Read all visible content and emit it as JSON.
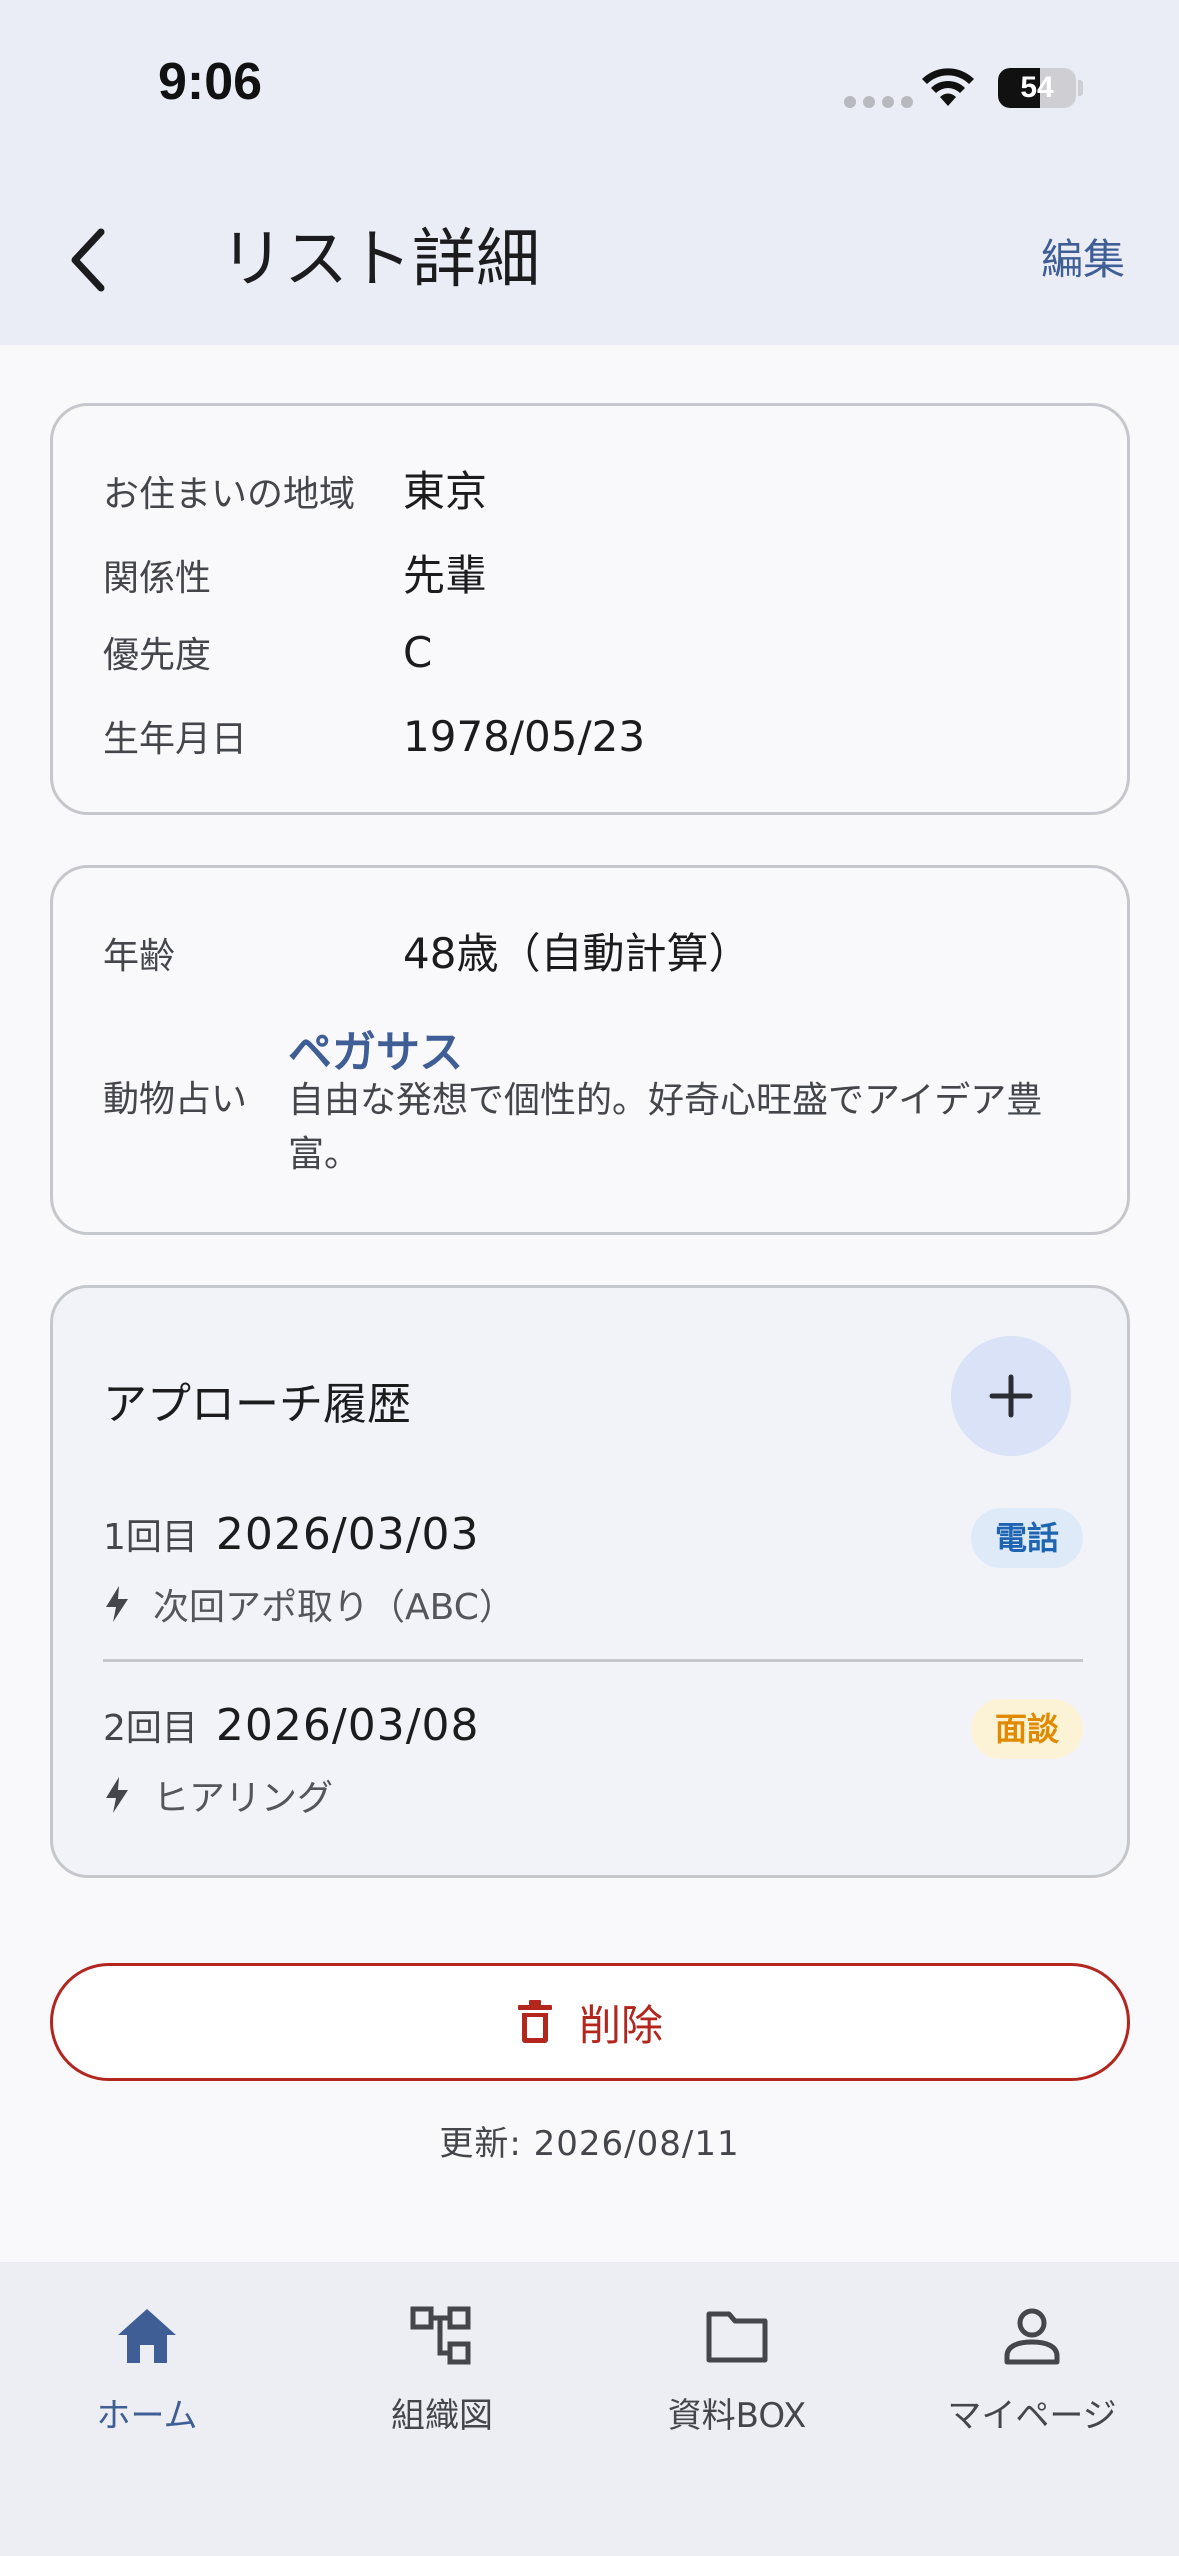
{
  "status_bar": {
    "time": "9:06",
    "battery": "54",
    "battery_level": 0.54
  },
  "header": {
    "title": "リスト詳細",
    "edit_label": "編集"
  },
  "profile": {
    "rows": [
      {
        "label": "お住まいの地域",
        "value": "東京"
      },
      {
        "label": "関係性",
        "value": "先輩"
      },
      {
        "label": "優先度",
        "value": "C"
      },
      {
        "label": "生年月日",
        "value": "1978/05/23"
      }
    ]
  },
  "age_card": {
    "age_label": "年齢",
    "age_value": "48歳（自動計算）",
    "animal_label": "動物占い",
    "animal_name": "ペガサス",
    "animal_description": "自由な発想で個性的。好奇心旺盛でアイデア豊富。"
  },
  "approach_history": {
    "title": "アプローチ履歴",
    "entries": [
      {
        "count": "1回目",
        "date": "2026/03/03",
        "note": "次回アポ取り（ABC）",
        "badge": "電話"
      },
      {
        "count": "2回目",
        "date": "2026/03/08",
        "note": "ヒアリング",
        "badge": "面談"
      }
    ]
  },
  "actions": {
    "delete_label": "削除"
  },
  "updated": "更新: 2026/08/11",
  "bottom_nav": {
    "items": [
      {
        "label": "ホーム",
        "icon": "home-icon",
        "active": true
      },
      {
        "label": "組織図",
        "icon": "org-chart-icon",
        "active": false
      },
      {
        "label": "資料BOX",
        "icon": "folder-icon",
        "active": false
      },
      {
        "label": "マイページ",
        "icon": "person-icon",
        "active": false
      }
    ]
  },
  "colors": {
    "accent": "#3f5e95",
    "danger": "#b3261e",
    "badge_phone": "#1f64b0",
    "badge_meeting": "#e08a00"
  }
}
